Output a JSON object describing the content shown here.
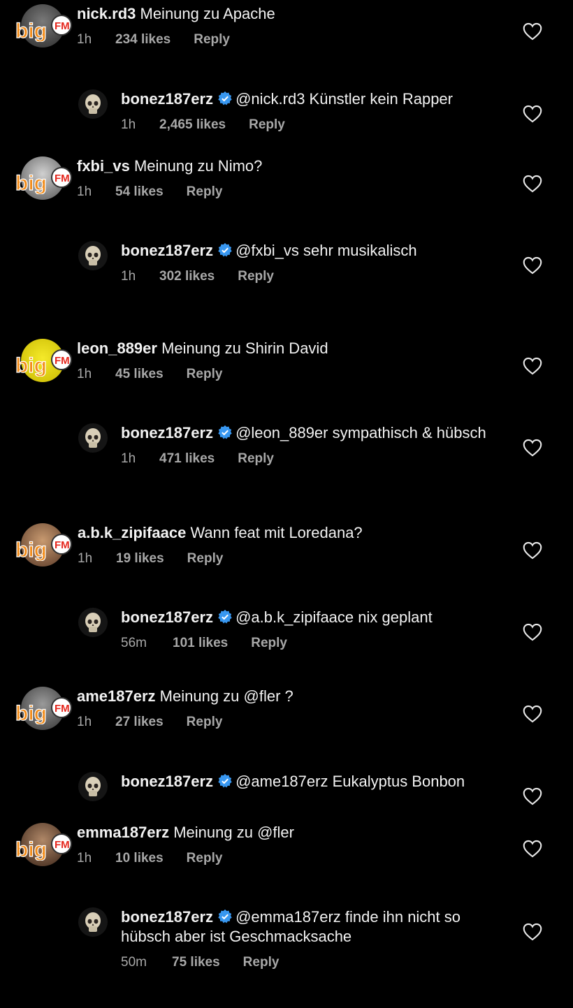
{
  "verified_color": "#3897f0",
  "logo_text": "bigFM",
  "threads": [
    {
      "user": "nick.rd3",
      "text": "Meinung zu Apache",
      "time": "1h",
      "likes": "234 likes",
      "reply_label": "Reply",
      "reply": {
        "user": "bonez187erz",
        "text": "@nick.rd3 Künstler kein Rapper",
        "time": "1h",
        "likes": "2,465 likes",
        "reply_label": "Reply"
      }
    },
    {
      "user": "fxbi_vs",
      "text": "Meinung zu Nimo?",
      "time": "1h",
      "likes": "54 likes",
      "reply_label": "Reply",
      "reply": {
        "user": "bonez187erz",
        "text": "@fxbi_vs sehr musikalisch",
        "time": "1h",
        "likes": "302 likes",
        "reply_label": "Reply"
      }
    },
    {
      "user": "leon_889er",
      "text": "Meinung zu Shirin David",
      "time": "1h",
      "likes": "45 likes",
      "reply_label": "Reply",
      "reply": {
        "user": "bonez187erz",
        "text": "@leon_889er sympathisch & hübsch",
        "time": "1h",
        "likes": "471 likes",
        "reply_label": "Reply"
      }
    },
    {
      "user": "a.b.k_zipifaace",
      "text": "Wann feat mit Loredana?",
      "time": "1h",
      "likes": "19 likes",
      "reply_label": "Reply",
      "reply": {
        "user": "bonez187erz",
        "text": "@a.b.k_zipifaace nix geplant",
        "time": "56m",
        "likes": "101 likes",
        "reply_label": "Reply"
      }
    },
    {
      "user": "ame187erz",
      "text": "Meinung zu @fler ?",
      "time": "1h",
      "likes": "27 likes",
      "reply_label": "Reply",
      "reply": {
        "user": "bonez187erz",
        "text": "@ame187erz Eukalyptus Bonbon"
      }
    },
    {
      "user": "emma187erz",
      "text": "Meinung zu @fler",
      "time": "1h",
      "likes": "10 likes",
      "reply_label": "Reply",
      "reply": {
        "user": "bonez187erz",
        "text": "@emma187erz finde ihn nicht so hübsch aber ist Geschmacksache",
        "time": "50m",
        "likes": "75 likes",
        "reply_label": "Reply"
      }
    }
  ]
}
